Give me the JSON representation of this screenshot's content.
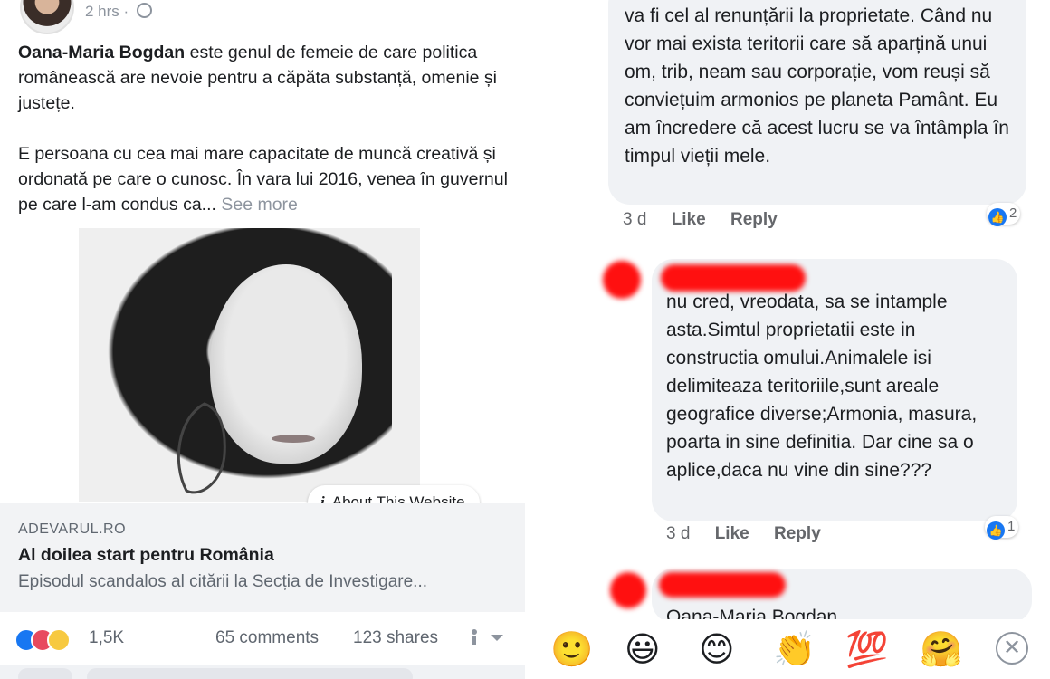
{
  "post": {
    "time": "2 hrs ·",
    "author_name": "Oana-Maria Bogdan",
    "text_after_author": " este genul de femeie de care politica românească are nevoie pentru a căpăta substanță, omenie și justețe.",
    "paragraph2": "E persoana cu cea mai mare capacitate de muncă creativă și ordonată pe care o cunosc. În vara lui 2016, venea în guvernul pe care l-am condus ca...",
    "see_more": "See more",
    "about_website": "About This Website",
    "link": {
      "domain": "ADEVARUL.RO",
      "title": "Al doilea start pentru România",
      "description": "Episodul scandalos al citării la Secția de Investigare..."
    },
    "stats": {
      "reactions": "1,5K",
      "comments": "65 comments",
      "shares": "123 shares"
    }
  },
  "comments": [
    {
      "text": "va fi cel al renunțării la proprietate. Când nu vor mai exista teritorii care să aparțină unui om, trib, neam sau corporație, vom reuși să conviețuim armonios pe planeta Pamânt. Eu am încredere că acest lucru se va întâmpla în timpul vieții mele.",
      "time": "3 d",
      "like": "Like",
      "reply": "Reply",
      "like_count": "2"
    },
    {
      "text": "nu cred, vreodata, sa se intample asta.Simtul proprietatii este in constructia omului.Animalele isi delimiteaza teritoriile,sunt areale geografice diverse;Armonia, masura, poarta in sine definitia. Dar cine sa o aplice,daca nu vine din sine???",
      "time": "3 d",
      "like": "Like",
      "reply": "Reply",
      "like_count": "1"
    },
    {
      "text": "Oana-Maria Bogdan"
    }
  ],
  "emoji_bar": [
    "🙂",
    "😃",
    "😊",
    "👏",
    "💯",
    "🤗"
  ],
  "close_symbol": "✕",
  "colors": {
    "accent": "#1877f2",
    "redaction": "#ff1010",
    "bubble": "#f0f2f5"
  },
  "icons": [
    "globe-icon",
    "info-icon",
    "like-reaction-icon",
    "love-reaction-icon",
    "haha-reaction-icon",
    "close-icon"
  ]
}
